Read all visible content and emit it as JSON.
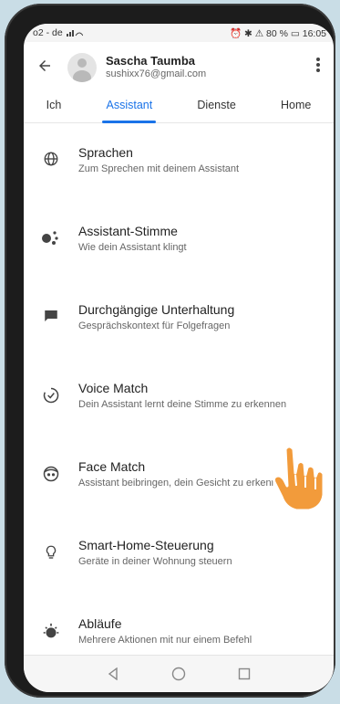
{
  "status": {
    "carrier": "o2 - de",
    "right": "⏰ ✱ ⚠ 80 % ▭ 16:05"
  },
  "header": {
    "name": "Sascha Taumba",
    "email": "sushixx76@gmail.com",
    "back_icon": "arrow-left-icon",
    "more_icon": "more-vert-icon"
  },
  "tabs": [
    {
      "label": "Ich"
    },
    {
      "label": "Assistant",
      "active": true
    },
    {
      "label": "Dienste"
    },
    {
      "label": "Home"
    }
  ],
  "items": [
    {
      "icon": "globe-icon",
      "title": "Sprachen",
      "subtitle": "Zum Sprechen mit deinem Assistant"
    },
    {
      "icon": "assistant-dots-icon",
      "title": "Assistant-Stimme",
      "subtitle": "Wie dein Assistant klingt"
    },
    {
      "icon": "chat-icon",
      "title": "Durchgängige Unterhaltung",
      "subtitle": "Gesprächskontext für Folgefragen"
    },
    {
      "icon": "voice-match-icon",
      "title": "Voice Match",
      "subtitle": "Dein Assistant lernt deine Stimme zu erkennen"
    },
    {
      "icon": "face-icon",
      "title": "Face Match",
      "subtitle": "Assistant beibringen, dein Gesicht zu erkennen"
    },
    {
      "icon": "lightbulb-icon",
      "title": "Smart-Home-Steuerung",
      "subtitle": "Geräte in deiner Wohnung steuern"
    },
    {
      "icon": "routine-icon",
      "title": "Abläufe",
      "subtitle": "Mehrere Aktionen mit nur einem Befehl"
    }
  ],
  "navbar": {
    "back_icon": "nav-back-triangle-icon",
    "home_icon": "nav-home-circle-icon",
    "recents_icon": "nav-recents-square-icon"
  },
  "colors": {
    "accent": "#1a73e8",
    "hand": "#f29b3b"
  }
}
